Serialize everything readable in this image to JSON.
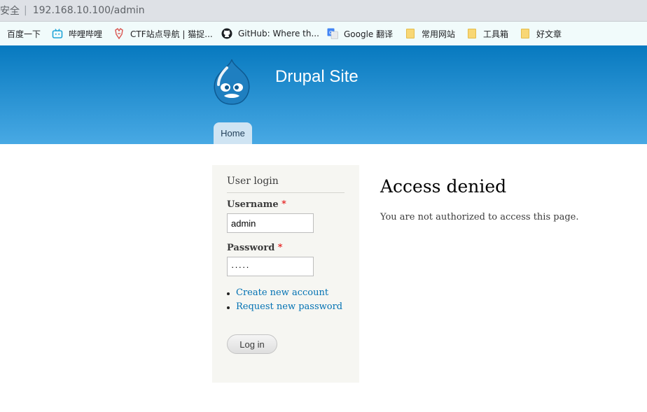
{
  "browser": {
    "security_label": "安全",
    "separator": "|",
    "url": "192.168.10.100/admin"
  },
  "bookmarks": [
    {
      "label": "百度一下",
      "icon": "none"
    },
    {
      "label": "哔哩哔哩",
      "icon": "bilibili-icon"
    },
    {
      "label": "CTF站点导航 | 猫捉...",
      "icon": "ctf-icon"
    },
    {
      "label": "GitHub: Where th...",
      "icon": "github-icon"
    },
    {
      "label": "Google 翻译",
      "icon": "google-translate-icon"
    },
    {
      "label": "常用网站",
      "icon": "folder-icon"
    },
    {
      "label": "工具箱",
      "icon": "folder-icon"
    },
    {
      "label": "好文章",
      "icon": "folder-icon"
    }
  ],
  "site": {
    "name": "Drupal Site",
    "nav_home": "Home"
  },
  "login": {
    "block_title": "User login",
    "username_label": "Username",
    "username_value": "admin",
    "password_label": "Password",
    "password_value": "·····",
    "required_marker": "*",
    "create_account": "Create new account",
    "request_password": "Request new password",
    "submit_label": "Log in"
  },
  "content": {
    "title": "Access denied",
    "message": "You are not authorized to access this page."
  },
  "colors": {
    "header_top": "#0779bf",
    "header_bottom": "#48a9e4",
    "link": "#0071b3",
    "required": "#e30000"
  }
}
